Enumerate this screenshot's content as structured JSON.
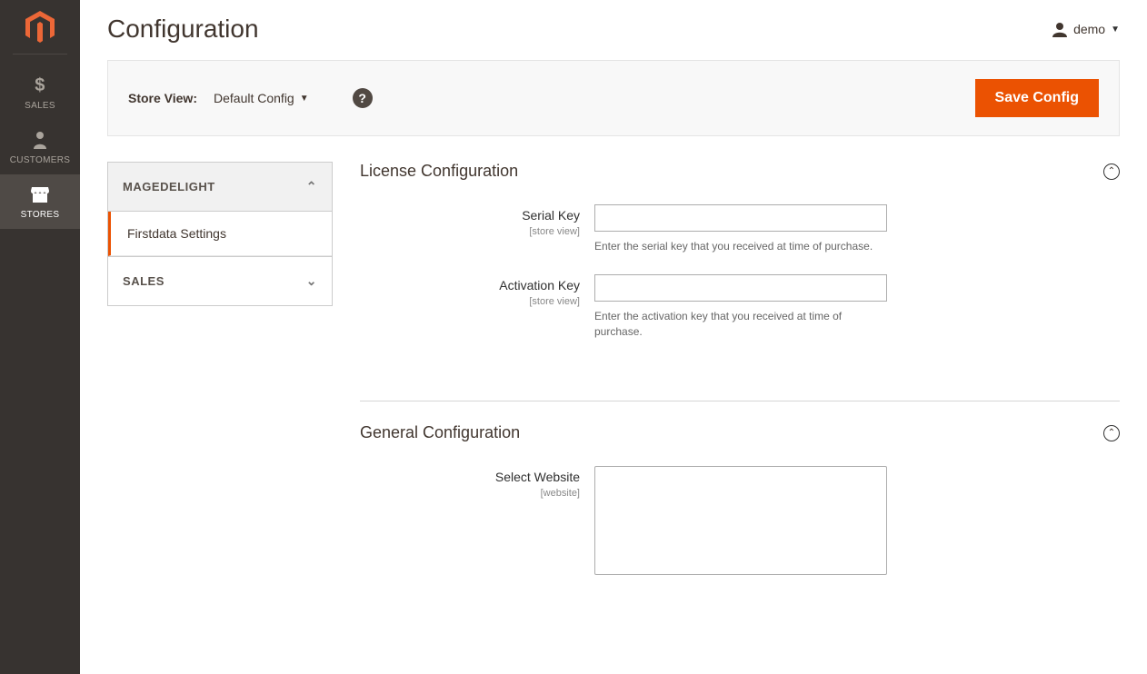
{
  "sidebar": {
    "items": [
      {
        "label": "SALES",
        "icon": "dollar"
      },
      {
        "label": "CUSTOMERS",
        "icon": "person"
      },
      {
        "label": "STORES",
        "icon": "store"
      }
    ]
  },
  "header": {
    "title": "Configuration",
    "user": "demo"
  },
  "bar": {
    "store_view_label": "Store View:",
    "store_view_value": "Default Config",
    "save_label": "Save Config"
  },
  "side_nav": {
    "sections": [
      {
        "label": "MAGEDELIGHT",
        "items": [
          {
            "label": "Firstdata Settings"
          }
        ]
      },
      {
        "label": "SALES",
        "items": []
      }
    ]
  },
  "fieldsets": [
    {
      "title": "License Configuration",
      "fields": [
        {
          "label": "Serial Key",
          "scope": "[store view]",
          "note": "Enter the serial key that you received at time of purchase.",
          "type": "text"
        },
        {
          "label": "Activation Key",
          "scope": "[store view]",
          "note": "Enter the activation key that you received at time of purchase.",
          "type": "text"
        }
      ]
    },
    {
      "title": "General Configuration",
      "fields": [
        {
          "label": "Select Website",
          "scope": "[website]",
          "type": "multiselect"
        }
      ]
    }
  ]
}
